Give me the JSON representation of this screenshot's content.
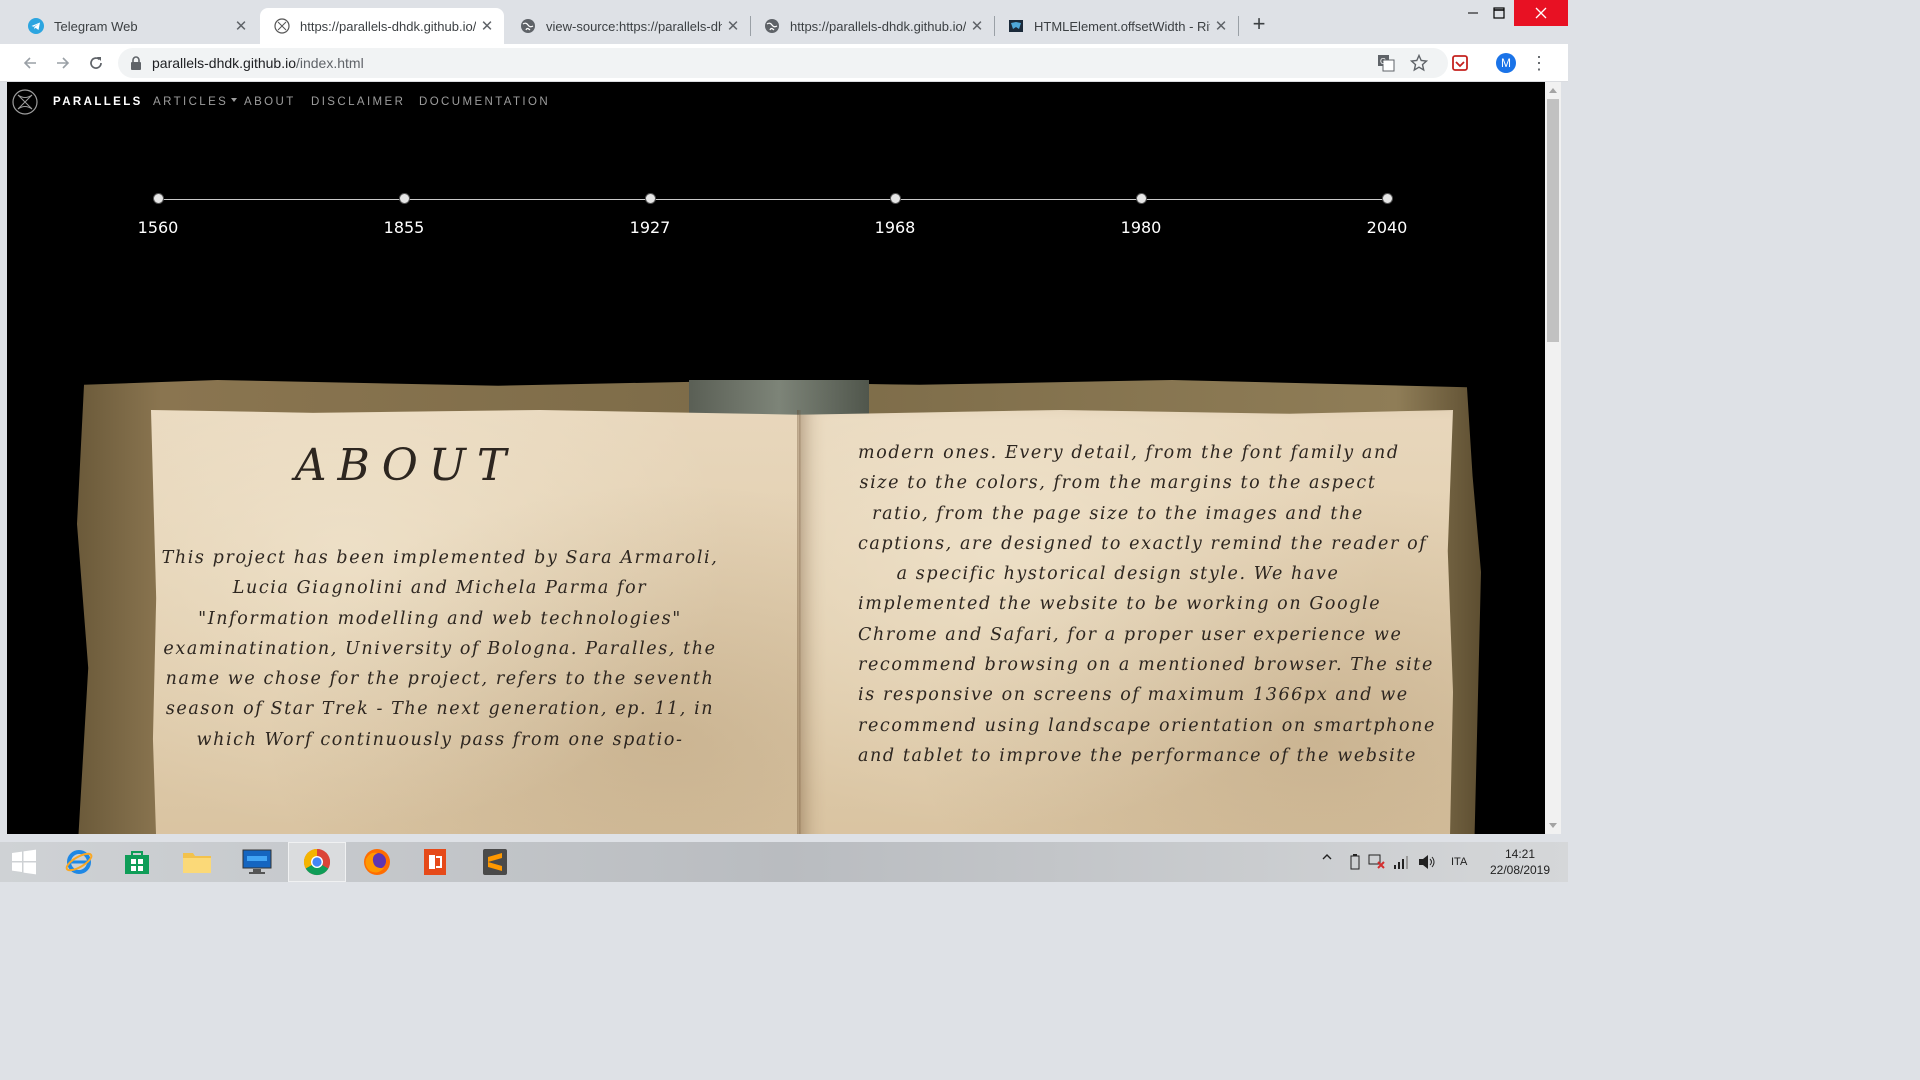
{
  "browser": {
    "tabs": [
      {
        "title": "Telegram Web",
        "icon": "telegram-icon",
        "active": false
      },
      {
        "title": "https://parallels-dhdk.github.io/index.html",
        "icon": "parallels-favicon",
        "active": true
      },
      {
        "title": "view-source:https://parallels-dhdk.github.io/",
        "icon": "globe-icon",
        "active": false
      },
      {
        "title": "https://parallels-dhdk.github.io/js",
        "icon": "globe-icon",
        "active": false
      },
      {
        "title": "HTMLElement.offsetWidth - Riferimento",
        "icon": "mdn-icon",
        "active": false
      }
    ],
    "new_tab_label": "+",
    "url_host": "parallels-dhdk.github.io",
    "url_path": "/index.html",
    "avatar_initial": "M"
  },
  "site": {
    "brand": "PARALLELS",
    "nav": [
      {
        "label": "ARTICLES",
        "dropdown": true
      },
      {
        "label": "ABOUT",
        "dropdown": false
      },
      {
        "label": "DISCLAIMER",
        "dropdown": false
      },
      {
        "label": "DOCUMENTATION",
        "dropdown": false
      }
    ],
    "timeline": [
      "1560",
      "1855",
      "1927",
      "1968",
      "1980",
      "2040"
    ],
    "about_title": "ABOUT",
    "left_lines": [
      "This project has been implemented by Sara Armaroli,",
      "Lucia Giagnolini and Michela Parma for",
      "\"Information modelling and web technologies\"",
      "examinatination, University of Bologna. Paralles, the",
      "name we chose for the project, refers to the seventh",
      "season of Star Trek - The next generation, ep. 11, in",
      "which Worf continuously pass from one spatio-"
    ],
    "right_lines": [
      "modern ones. Every detail, from the font family and",
      "size to the colors, from the margins to the aspect",
      "ratio, from the page size to the images and the",
      "captions, are designed to exactly remind the reader of",
      "a specific hystorical design style. We have",
      "implemented the website to be working on Google",
      "Chrome and Safari, for a proper user experience we",
      "recommend browsing on a mentioned browser. The site",
      "is responsive on screens of maximum 1366px and we",
      "recommend using landscape orientation on smartphone",
      "and tablet to improve the performance of the website"
    ]
  },
  "taskbar": {
    "apps": [
      "internet-explorer-icon",
      "store-icon",
      "file-explorer-icon",
      "lenovo-icon",
      "chrome-icon",
      "firefox-icon",
      "office-icon",
      "sublime-text-icon"
    ],
    "language": "ITA",
    "time": "14:21",
    "date": "22/08/2019"
  },
  "colors": {
    "page_bg": "#000000",
    "nav_link": "#9d9d9d",
    "parchment": "#e2cfb0",
    "ink": "#2d2620",
    "close_red": "#e81123"
  }
}
